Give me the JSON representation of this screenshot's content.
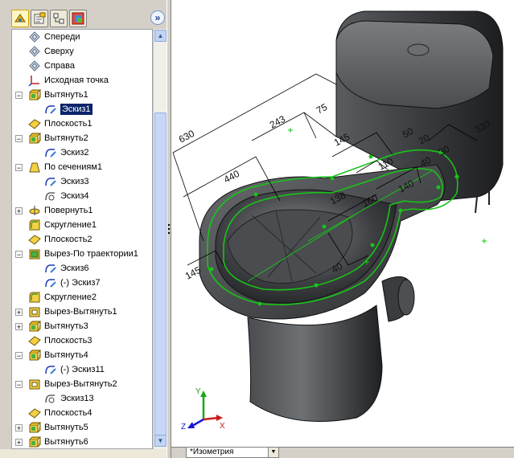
{
  "feature_tree": {
    "items": [
      {
        "label": "Спереди",
        "icon": "plane-icon",
        "expander": "",
        "indent": 0
      },
      {
        "label": "Сверху",
        "icon": "plane-icon",
        "expander": "",
        "indent": 0
      },
      {
        "label": "Справа",
        "icon": "plane-icon",
        "expander": "",
        "indent": 0
      },
      {
        "label": "Исходная точка",
        "icon": "origin-icon",
        "expander": "",
        "indent": 0
      },
      {
        "label": "Вытянуть1",
        "icon": "extrude-icon",
        "expander": "−",
        "indent": 0
      },
      {
        "label": "Эскиз1",
        "icon": "sketch-icon",
        "expander": "",
        "indent": 1,
        "selected": true
      },
      {
        "label": "Плоскость1",
        "icon": "plane-feature-icon",
        "expander": "",
        "indent": 0
      },
      {
        "label": "Вытянуть2",
        "icon": "extrude-icon",
        "expander": "−",
        "indent": 0
      },
      {
        "label": "Эскиз2",
        "icon": "sketch-icon",
        "expander": "",
        "indent": 1
      },
      {
        "label": "По сечениям1",
        "icon": "loft-icon",
        "expander": "−",
        "indent": 0
      },
      {
        "label": "Эскиз3",
        "icon": "sketch-icon",
        "expander": "",
        "indent": 1
      },
      {
        "label": "Эскиз4",
        "icon": "sketch-3d-icon",
        "expander": "",
        "indent": 1
      },
      {
        "label": "Повернуть1",
        "icon": "revolve-icon",
        "expander": "+",
        "indent": 0
      },
      {
        "label": "Скругление1",
        "icon": "fillet-icon",
        "expander": "",
        "indent": 0
      },
      {
        "label": "Плоскость2",
        "icon": "plane-feature-icon",
        "expander": "",
        "indent": 0
      },
      {
        "label": "Вырез-По траектории1",
        "icon": "sweep-cut-icon",
        "expander": "−",
        "indent": 0
      },
      {
        "label": "Эскиз6",
        "icon": "sketch-icon",
        "expander": "",
        "indent": 1
      },
      {
        "label": "(-) Эскиз7",
        "icon": "sketch-icon",
        "expander": "",
        "indent": 1
      },
      {
        "label": "Скругление2",
        "icon": "fillet-icon",
        "expander": "",
        "indent": 0
      },
      {
        "label": "Вырез-Вытянуть1",
        "icon": "cut-extrude-icon",
        "expander": "+",
        "indent": 0
      },
      {
        "label": "Вытянуть3",
        "icon": "extrude-icon",
        "expander": "+",
        "indent": 0
      },
      {
        "label": "Плоскость3",
        "icon": "plane-feature-icon",
        "expander": "",
        "indent": 0
      },
      {
        "label": "Вытянуть4",
        "icon": "extrude-icon",
        "expander": "−",
        "indent": 0
      },
      {
        "label": "(-) Эскиз11",
        "icon": "sketch-icon",
        "expander": "",
        "indent": 1
      },
      {
        "label": "Вырез-Вытянуть2",
        "icon": "cut-extrude-icon",
        "expander": "−",
        "indent": 0
      },
      {
        "label": "Эскиз13",
        "icon": "sketch-3d-icon",
        "expander": "",
        "indent": 1
      },
      {
        "label": "Плоскость4",
        "icon": "plane-feature-icon",
        "expander": "",
        "indent": 0
      },
      {
        "label": "Вытянуть5",
        "icon": "extrude-icon",
        "expander": "+",
        "indent": 0
      },
      {
        "label": "Вытянуть6",
        "icon": "extrude-icon",
        "expander": "+",
        "indent": 0
      }
    ]
  },
  "toolbar": {
    "tabs": [
      "feature-manager-tab-icon",
      "property-manager-tab-icon",
      "configuration-manager-tab-icon",
      "dimxpert-tab-icon"
    ],
    "collapse_label": "»"
  },
  "viewport": {
    "dimensions": [
      "630",
      "243",
      "75",
      "145",
      "50",
      "330",
      "440",
      "40",
      "30",
      "20",
      "110",
      "140",
      "138",
      "160",
      "40",
      "145"
    ],
    "triad": {
      "x": "X",
      "y": "Y",
      "z": "Z"
    },
    "colors": {
      "model": "#2a2c2e",
      "sketch": "#18c418",
      "dim_lines": "#000000"
    }
  },
  "status": {
    "view_name": "*Изометрия",
    "dropdown_icon": "dropdown-arrow-icon"
  }
}
